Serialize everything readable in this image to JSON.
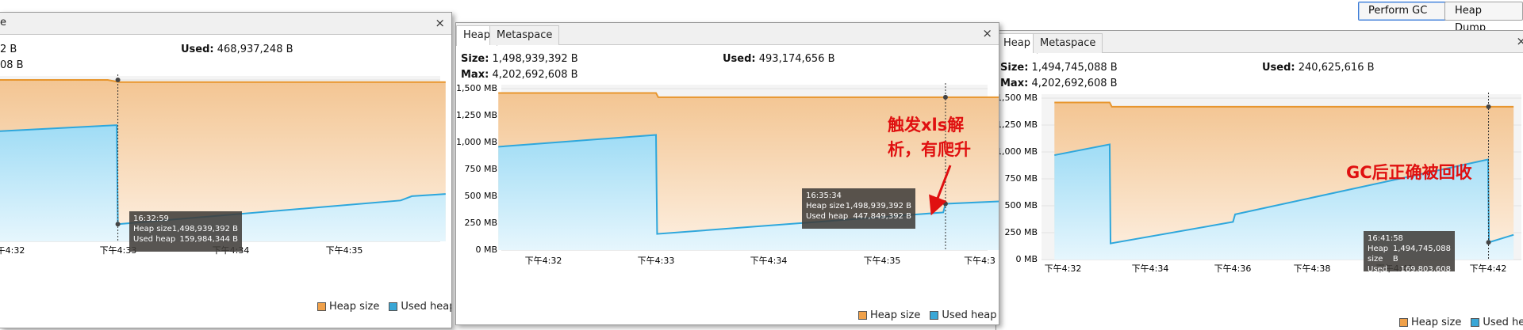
{
  "toolbar": {
    "perform_gc": "Perform GC",
    "heap_dump": "Heap Dump"
  },
  "windows": [
    {
      "title_fragment": "e",
      "close": "×",
      "size_label": "Size:",
      "size_value": "2 B",
      "used_label": "Used:",
      "used_value": "468,937,248 B",
      "max_label": "Max:",
      "max_value": "08 B",
      "x_ticks": [
        "下午4:32",
        "下午4:33",
        "下午4:34",
        "下午4:35"
      ],
      "tooltip": {
        "time": "16:32:59",
        "heap_label": "Heap size",
        "heap_value": "1,498,939,392 B",
        "used_label": "Used heap",
        "used_value": "159,984,344 B"
      },
      "legend": {
        "heap": "Heap size",
        "used": "Used heap"
      }
    },
    {
      "tabs": [
        "Heap",
        "Metaspace"
      ],
      "close": "×",
      "size_label": "Size:",
      "size_value": "1,498,939,392 B",
      "used_label": "Used:",
      "used_value": "493,174,656 B",
      "max_label": "Max:",
      "max_value": "4,202,692,608 B",
      "y_ticks": [
        "1,500 MB",
        "1,250 MB",
        "1,000 MB",
        "750 MB",
        "500 MB",
        "250 MB",
        "0 MB"
      ],
      "x_ticks": [
        "下午4:32",
        "下午4:33",
        "下午4:34",
        "下午4:35",
        "下午4:3"
      ],
      "tooltip": {
        "time": "16:35:34",
        "heap_label": "Heap size",
        "heap_value": "1,498,939,392 B",
        "used_label": "Used heap",
        "used_value": "447,849,392 B"
      },
      "annotation_line1": "触发xls解",
      "annotation_line2": "析，有爬升",
      "legend": {
        "heap": "Heap size",
        "used": "Used heap"
      }
    },
    {
      "tabs": [
        "Heap",
        "Metaspace"
      ],
      "close": "×",
      "size_label": "Size:",
      "size_value": "1,494,745,088 B",
      "used_label": "Used:",
      "used_value": "240,625,616 B",
      "max_label": "Max:",
      "max_value": "4,202,692,608 B",
      "y_ticks": [
        "1,500 MB",
        "1,250 MB",
        "1,000 MB",
        "750 MB",
        "500 MB",
        "250 MB",
        "0 MB"
      ],
      "x_ticks": [
        "下午4:32",
        "下午4:34",
        "下午4:36",
        "下午4:38",
        "下午4:40",
        "下午4:42"
      ],
      "tooltip": {
        "time": "16:41:58",
        "heap_label": "Heap size",
        "heap_value": "1,494,745,088 B",
        "used_label": "Used heap",
        "used_value": "169,803,608 B"
      },
      "annotation": "GC后正确被回收",
      "legend": {
        "heap": "Heap size",
        "used": "Used heap"
      }
    }
  ],
  "chart_data": [
    {
      "type": "area",
      "x_unit": "time",
      "series": [
        {
          "name": "Heap size",
          "color": "#e8962e",
          "points": [
            [
              "4:31.5",
              1500
            ],
            [
              "4:32.9",
              1500
            ],
            [
              "4:33",
              1480
            ],
            [
              "4:35.9",
              1480
            ]
          ]
        },
        {
          "name": "Used heap",
          "color": "#2ea7dc",
          "points": [
            [
              "4:31.5",
              1000
            ],
            [
              "4:32.98",
              1080
            ],
            [
              "4:32.99",
              160
            ],
            [
              "4:35.5",
              380
            ],
            [
              "4:35.6",
              420
            ],
            [
              "4:35.9",
              440
            ]
          ]
        }
      ]
    },
    {
      "type": "area",
      "x_unit": "time",
      "ylim": [
        0,
        1500
      ],
      "series": [
        {
          "name": "Heap size",
          "color": "#e8962e",
          "points": [
            [
              "4:31.6",
              1460
            ],
            [
              "4:33",
              1460
            ],
            [
              "4:33.02",
              1420
            ],
            [
              "4:36.2",
              1420
            ]
          ]
        },
        {
          "name": "Used heap",
          "color": "#2ea7dc",
          "points": [
            [
              "4:31.6",
              960
            ],
            [
              "4:33",
              1070
            ],
            [
              "4:33.01",
              150
            ],
            [
              "4:35.55",
              350
            ],
            [
              "4:35.57",
              430
            ],
            [
              "4:36.2",
              460
            ]
          ]
        }
      ]
    },
    {
      "type": "area",
      "x_unit": "time",
      "ylim": [
        0,
        1500
      ],
      "series": [
        {
          "name": "Heap size",
          "color": "#e8962e",
          "points": [
            [
              "4:31.8",
              1460
            ],
            [
              "4:33.1",
              1460
            ],
            [
              "4:33.15",
              1420
            ],
            [
              "4:42.6",
              1420
            ]
          ]
        },
        {
          "name": "Used heap",
          "color": "#2ea7dc",
          "points": [
            [
              "4:31.8",
              970
            ],
            [
              "4:33.1",
              1070
            ],
            [
              "4:33.12",
              150
            ],
            [
              "4:36",
              350
            ],
            [
              "4:36.05",
              420
            ],
            [
              "4:42",
              930
            ],
            [
              "4:42.02",
              160
            ],
            [
              "4:42.6",
              230
            ]
          ]
        }
      ]
    }
  ]
}
